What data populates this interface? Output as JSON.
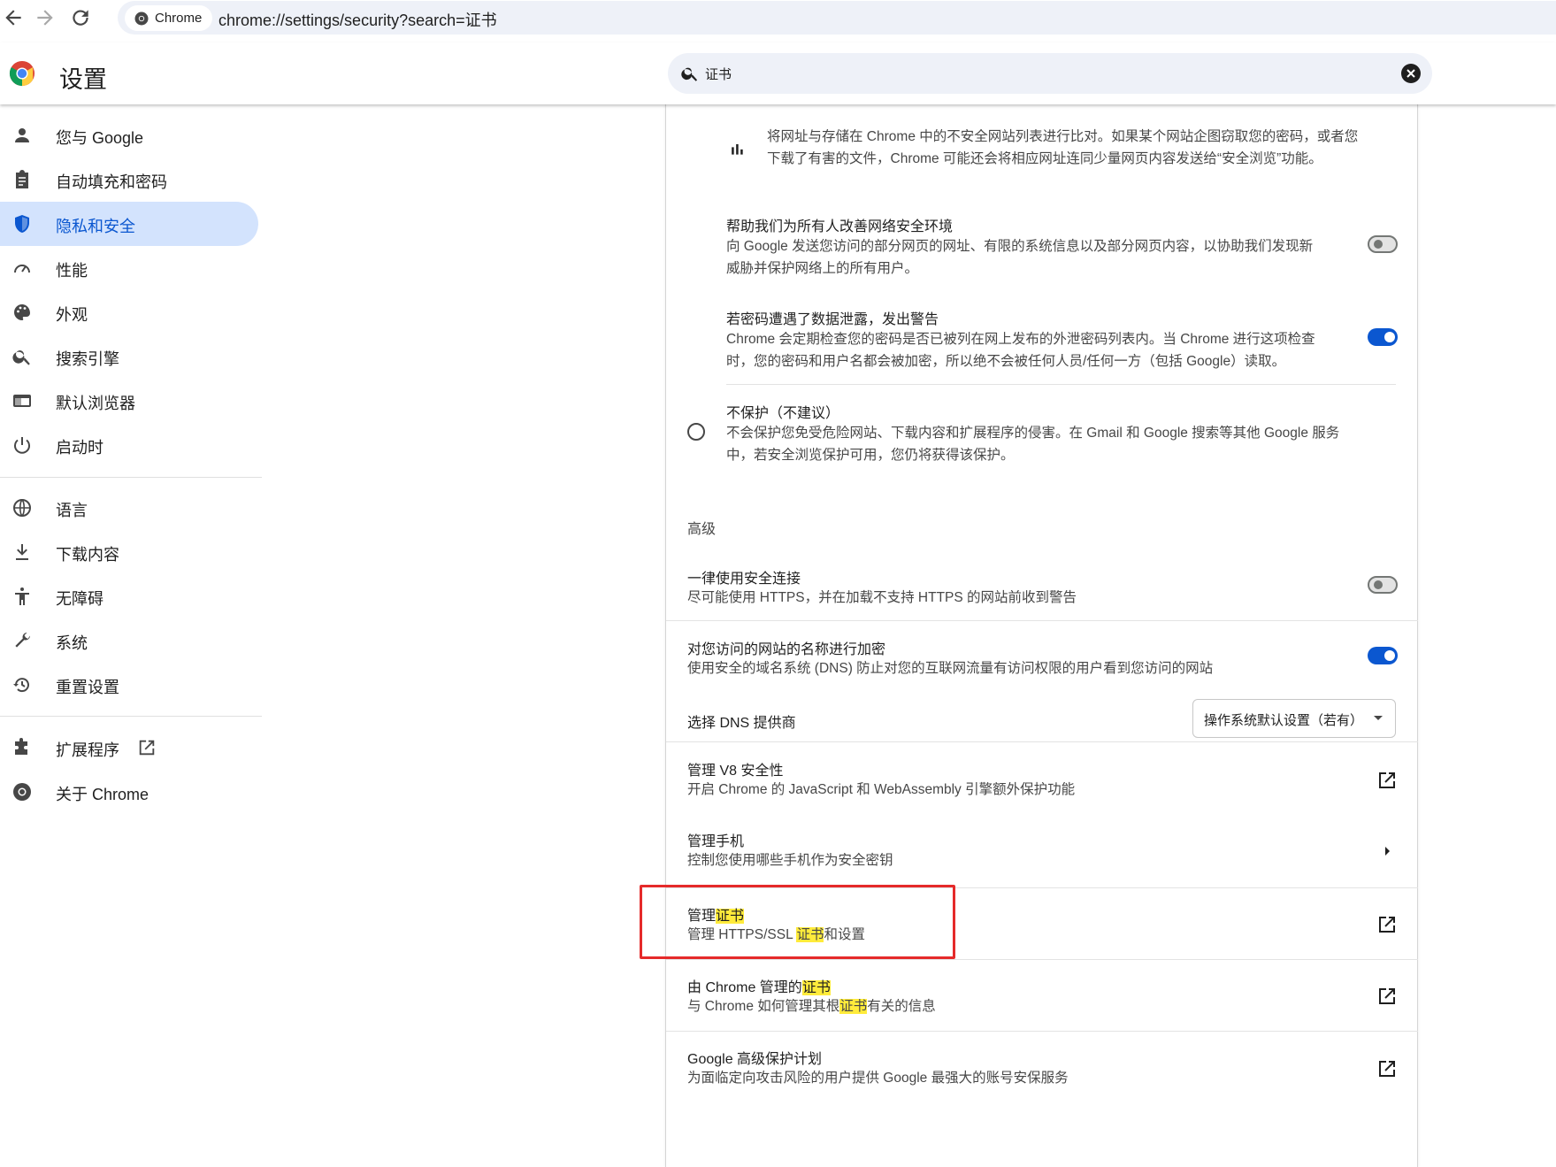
{
  "browser": {
    "site_chip_label": "Chrome",
    "url": "chrome://settings/security?search=证书"
  },
  "header": {
    "title": "设置",
    "search_value": "证书"
  },
  "sidebar": {
    "items": [
      {
        "label": "您与 Google",
        "icon": "person-icon"
      },
      {
        "label": "自动填充和密码",
        "icon": "clipboard-icon"
      },
      {
        "label": "隐私和安全",
        "icon": "shield-icon",
        "active": true
      },
      {
        "label": "性能",
        "icon": "speedometer-icon"
      },
      {
        "label": "外观",
        "icon": "palette-icon"
      },
      {
        "label": "搜索引擎",
        "icon": "search-icon"
      },
      {
        "label": "默认浏览器",
        "icon": "browser-window-icon"
      },
      {
        "label": "启动时",
        "icon": "power-icon"
      },
      {
        "label": "语言",
        "icon": "globe-icon"
      },
      {
        "label": "下载内容",
        "icon": "download-icon"
      },
      {
        "label": "无障碍",
        "icon": "accessibility-icon"
      },
      {
        "label": "系统",
        "icon": "wrench-icon"
      },
      {
        "label": "重置设置",
        "icon": "history-icon"
      },
      {
        "label": "扩展程序",
        "icon": "puzzle-icon"
      },
      {
        "label": "关于 Chrome",
        "icon": "chrome-logo-icon"
      }
    ]
  },
  "main": {
    "safe_browsing_note": {
      "line1": "将网址与存储在 Chrome 中的不安全网站列表进行比对。如果某个网站企图窃取您的密码，或者您",
      "line2": "下载了有害的文件，Chrome 可能还会将相应网址连同少量网页内容发送给“安全浏览”功能。"
    },
    "improve_security": {
      "title": "帮助我们为所有人改善网络安全环境",
      "line1": "向 Google 发送您访问的部分网页的网址、有限的系统信息以及部分网页内容，以协助我们发现新",
      "line2": "威胁并保护网络上的所有用户。",
      "enabled": false
    },
    "password_leak": {
      "title": "若密码遭遇了数据泄露，发出警告",
      "line1": "Chrome 会定期检查您的密码是否已被列在网上发布的外泄密码列表内。当 Chrome 进行这项检查",
      "line2": "时，您的密码和用户名都会被加密，所以绝不会被任何人员/任何一方（包括 Google）读取。",
      "enabled": true
    },
    "no_protection": {
      "title": "不保护（不建议）",
      "line1": "不会保护您免受危险网站、下载内容和扩展程序的侵害。在 Gmail 和 Google 搜索等其他 Google 服务",
      "line2": "中，若安全浏览保护可用，您仍将获得该保护。",
      "selected": false
    },
    "advanced_heading": "高级",
    "always_https": {
      "title": "一律使用安全连接",
      "desc": "尽可能使用 HTTPS，并在加载不支持 HTTPS 的网站前收到警告",
      "enabled": false
    },
    "secure_dns": {
      "title": "对您访问的网站的名称进行加密",
      "desc": "使用安全的域名系统 (DNS) 防止对您的互联网流量有访问权限的用户看到您访问的网站",
      "enabled": true
    },
    "dns_provider": {
      "label": "选择 DNS 提供商",
      "selected": "操作系统默认设置（若有）"
    },
    "v8_security": {
      "title": "管理 V8 安全性",
      "desc": "开启 Chrome 的 JavaScript 和 WebAssembly 引擎额外保护功能"
    },
    "manage_phones": {
      "title": "管理手机",
      "desc": "控制您使用哪些手机作为安全密钥"
    },
    "manage_certificates": {
      "title_prefix": "管理",
      "title_highlight": "证书",
      "desc_prefix": "管理 HTTPS/SSL ",
      "desc_highlight": "证书",
      "desc_suffix": "和设置"
    },
    "chrome_managed_certificates": {
      "title_prefix": "由 Chrome 管理的",
      "title_highlight": "证书",
      "desc_prefix": "与 Chrome 如何管理其根",
      "desc_highlight": "证书",
      "desc_suffix": "有关的信息"
    },
    "advanced_protection": {
      "title": "Google 高级保护计划",
      "desc": "为面临定向攻击风险的用户提供 Google 最强大的账号安保服务"
    }
  },
  "colors": {
    "accent": "#0b57d0",
    "active_nav_bg": "#d3e3fd",
    "highlight": "#ffeb3b",
    "annotation_box": "#e52a2a"
  }
}
